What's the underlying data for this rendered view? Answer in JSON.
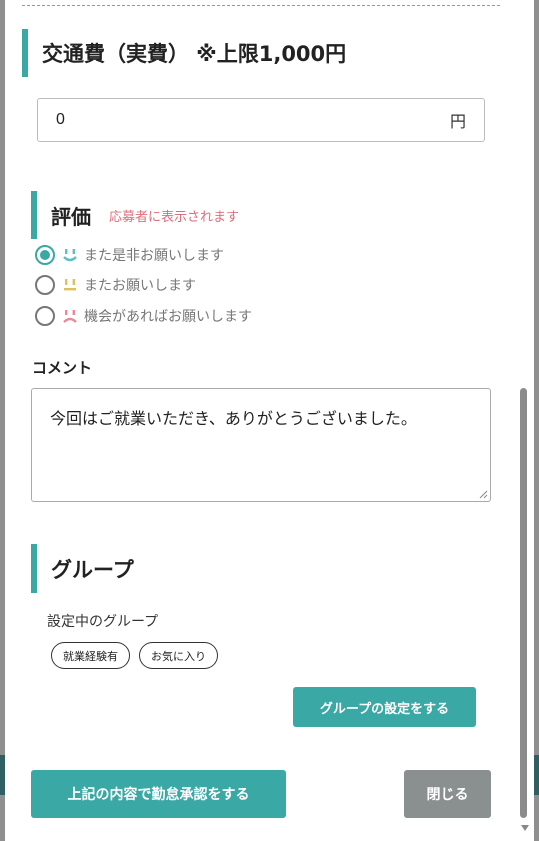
{
  "fare": {
    "title": "交通費（実費） ※上限1,000円",
    "value": "0",
    "unit": "円"
  },
  "evaluation": {
    "title": "評価",
    "note": "応募者に表示されます",
    "options": [
      {
        "label": "また是非お願いします",
        "selected": true,
        "icon": "smile-face-icon",
        "color": "#5bc0c4"
      },
      {
        "label": "またお願いします",
        "selected": false,
        "icon": "neutral-face-icon",
        "color": "#e0c05a"
      },
      {
        "label": "機会があればお願いします",
        "selected": false,
        "icon": "sad-face-icon",
        "color": "#e88a96"
      }
    ]
  },
  "comment": {
    "label": "コメント",
    "value": "今回はご就業いただき、ありがとうございました。"
  },
  "group": {
    "title": "グループ",
    "subtitle": "設定中のグループ",
    "tags": [
      "就業経験有",
      "お気に入り"
    ],
    "set_button": "グループの設定をする"
  },
  "actions": {
    "approve": "上記の内容で勤怠承認をする",
    "close": "閉じる"
  },
  "colors": {
    "accent": "#3aa8a4",
    "note": "#e06d7c",
    "close_button": "#8a8f90"
  }
}
